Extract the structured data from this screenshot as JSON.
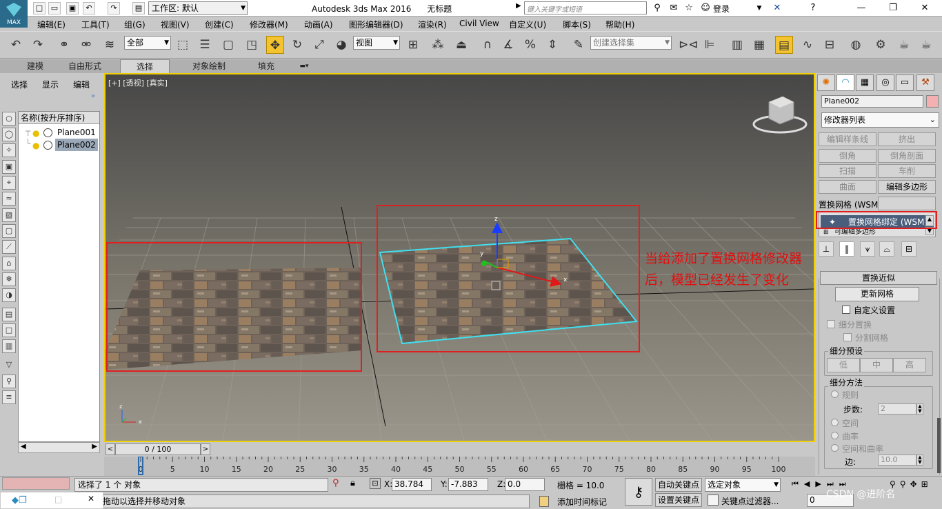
{
  "titlebar": {
    "logo_label": "MAX",
    "workspace": "工作区: 默认",
    "app_title": "Autodesk 3ds Max 2016",
    "doc_title": "无标题",
    "search_placeholder": "键入关键字或短语",
    "login": "登录"
  },
  "menubar": [
    "编辑(E)",
    "工具(T)",
    "组(G)",
    "视图(V)",
    "创建(C)",
    "修改器(M)",
    "动画(A)",
    "图形编辑器(D)",
    "渲染(R)",
    "Civil View",
    "自定义(U)",
    "脚本(S)",
    "帮助(H)"
  ],
  "toolbar": {
    "selection_filter": "全部",
    "ref_coord": "视图",
    "named_sel_placeholder": "创建选择集"
  },
  "ribbon_tabs": [
    "建模",
    "自由形式",
    "选择",
    "对象绘制",
    "填充"
  ],
  "scene_explorer": {
    "tabs": [
      "选择",
      "显示",
      "编辑"
    ],
    "header": "名称(按升序排序)",
    "objects": [
      {
        "name": "Plane001",
        "selected": false
      },
      {
        "name": "Plane002",
        "selected": true
      }
    ]
  },
  "viewport": {
    "label": "[+] [透视] [真实]",
    "annotation_line1": "当给添加了置换网格修改器",
    "annotation_line2": "后，模型已经发生了变化",
    "gizmo_axes": [
      "x",
      "y",
      "z"
    ],
    "colors": {
      "highlight_box": "#e02020",
      "selection_outline": "#40e0f0",
      "border": "#f0d000"
    }
  },
  "command_panel": {
    "object_name": "Plane002",
    "object_color": "#f4b0b0",
    "modifier_list": "修改器列表",
    "modifier_buttons": [
      {
        "label": "编辑样条线",
        "enabled": false
      },
      {
        "label": "挤出",
        "enabled": false
      },
      {
        "label": "倒角",
        "enabled": false
      },
      {
        "label": "倒角剖面",
        "enabled": false
      },
      {
        "label": "扫描",
        "enabled": false
      },
      {
        "label": "车削",
        "enabled": false
      },
      {
        "label": "曲面",
        "enabled": false
      },
      {
        "label": "编辑多边形",
        "enabled": true
      }
    ],
    "wsm_label": "置换网格 (WSM)",
    "stack": [
      "置换网格绑定 (WSM)",
      "可编辑多边形"
    ],
    "rollout_title": "置换近似",
    "update_button": "更新网格",
    "custom_settings": "自定义设置",
    "subdiv_displacement": "细分置换",
    "split_mesh": "分割网格",
    "subdiv_presets": {
      "title": "细分预设",
      "buttons": [
        "低",
        "中",
        "高"
      ]
    },
    "subdiv_method": {
      "title": "细分方法",
      "regular": "规则",
      "steps_label": "步数:",
      "steps_value": "2",
      "spatial": "空间",
      "curvature": "曲率",
      "spatial_curvature": "空间和曲率",
      "edge_label": "边:",
      "edge_value": "10.0"
    }
  },
  "timeline": {
    "current": "0 / 100",
    "ticks": [
      0,
      5,
      10,
      15,
      20,
      25,
      30,
      35,
      40,
      45,
      50,
      55,
      60,
      65,
      70,
      75,
      80,
      85,
      90,
      95,
      100
    ]
  },
  "statusbar": {
    "selection_info": "选择了 1 个 对象",
    "prompt": "单击并拖动以选择并移动对象",
    "x_label": "X:",
    "x_value": "38.784",
    "y_label": "Y:",
    "y_value": "-7.883",
    "z_label": "Z:",
    "z_value": "0.0",
    "grid": "栅格 = 10.0",
    "add_time_tag": "添加时间标记",
    "auto_key": "自动关键点",
    "set_key": "设置关键点",
    "selected_object": "选定对象",
    "key_filters": "关键点过滤器...",
    "frame_value": "0"
  },
  "watermark": "CSDN @进阶名"
}
